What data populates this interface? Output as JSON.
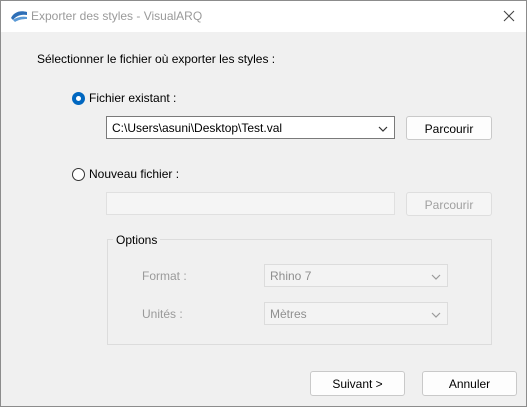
{
  "window": {
    "title": "Exporter des styles - VisualARQ"
  },
  "instruction": "Sélectionner le fichier où exporter les styles :",
  "existing_file": {
    "label": "Fichier existant :",
    "selected": true,
    "path": "C:\\Users\\asuni\\Desktop\\Test.val",
    "browse_label": "Parcourir"
  },
  "new_file": {
    "label": "Nouveau fichier :",
    "selected": false,
    "path": "",
    "browse_label": "Parcourir"
  },
  "options": {
    "title": "Options",
    "format_label": "Format :",
    "format_value": "Rhino 7",
    "units_label": "Unités :",
    "units_value": "Mètres"
  },
  "footer": {
    "next_label": "Suivant >",
    "cancel_label": "Annuler"
  },
  "icons": {
    "app": "visualarq-icon",
    "close": "close-icon",
    "dropdown": "chevron-down-icon"
  },
  "colors": {
    "accent": "#0067c0",
    "window_bg": "#f0f0f0",
    "titlebar_bg": "#ffffff"
  }
}
